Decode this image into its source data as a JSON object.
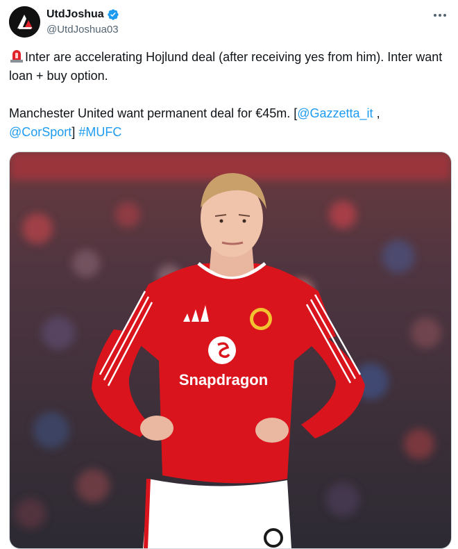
{
  "author": {
    "display_name": "UtdJoshua",
    "handle": "@UtdJoshua03",
    "verified_icon": "verified-badge-icon",
    "avatar_icon": "avatar-logo-icon"
  },
  "more_icon": "more-options-icon",
  "tweet": {
    "line1_emoji": "siren-emoji-icon",
    "line1": "Inter are accelerating Hojlund deal (after receiving yes from him). Inter want loan + buy option.",
    "line2_prefix": "Manchester United want permanent deal for €45m. [",
    "mention1": "@Gazzetta_it",
    "sep": " ,",
    "mention2": "@CorSport",
    "line2_mid": "] ",
    "hashtag": "#MUFC"
  },
  "media": {
    "sponsor_text": "Snapdragon",
    "colors": {
      "shirt": "#d9141c",
      "shorts": "#ffffff",
      "link": "#1d9bf0"
    }
  }
}
